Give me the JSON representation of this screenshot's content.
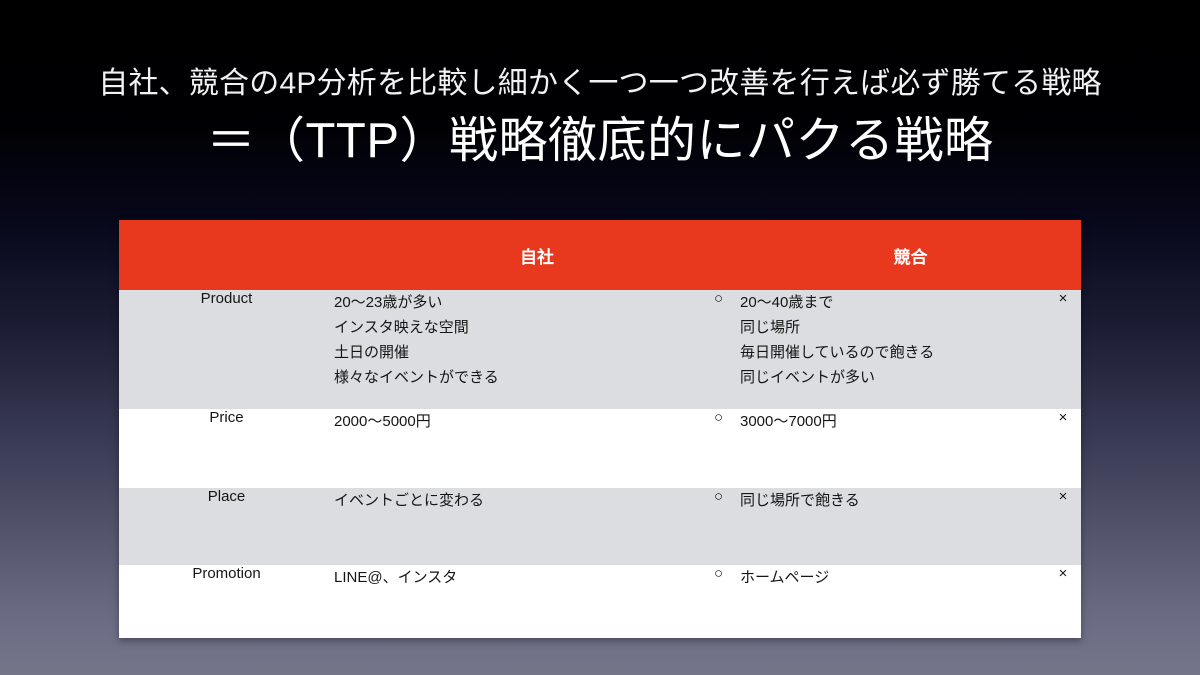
{
  "slide": {
    "title_line_1": "自社、競合の4P分析を比較し細かく一つ一つ改善を行えば必ず勝てる戦略",
    "title_line_2": "＝（TTP）戦略徹底的にパクる戦略",
    "accent_color": "#e8391e",
    "background_top_color": "#000000",
    "background_bottom_color": "#747589",
    "row_shade_color": "#dcdde0"
  },
  "table": {
    "headers": {
      "label_column": "",
      "own": "自社",
      "competitor": "競合"
    },
    "rows": [
      {
        "label": "Product",
        "own_text": "20〜23歳が多い\nインスタ映えな空間\n土日の開催\n様々なイベントができる",
        "own_mark": "○",
        "competitor_text": "20〜40歳まで\n同じ場所\n毎日開催しているので飽きる\n同じイベントが多い",
        "competitor_mark": "×"
      },
      {
        "label": "Price",
        "own_text": "2000〜5000円",
        "own_mark": "○",
        "competitor_text": "3000〜7000円",
        "competitor_mark": "×"
      },
      {
        "label": "Place",
        "own_text": "イベントごとに変わる",
        "own_mark": "○",
        "competitor_text": "同じ場所で飽きる",
        "competitor_mark": "×"
      },
      {
        "label": "Promotion",
        "own_text": "LINE@、インスタ",
        "own_mark": "○",
        "competitor_text": "ホームページ",
        "competitor_mark": "×"
      }
    ]
  }
}
